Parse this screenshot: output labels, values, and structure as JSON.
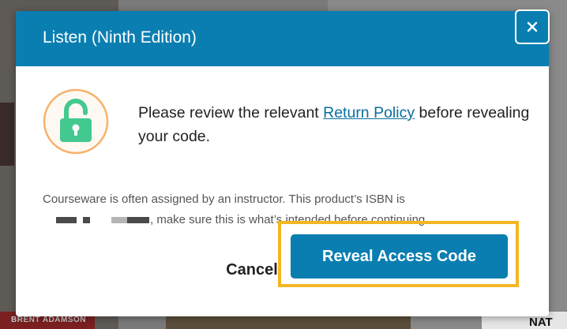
{
  "background": {
    "left_caption": "BRENT ADAMSON",
    "right_caption": "NAT"
  },
  "dialog": {
    "title": "Listen (Ninth Edition)",
    "close_icon": "close-icon",
    "lock_icon": "unlocked-padlock-icon",
    "message_before_link": "Please review the relevant ",
    "return_policy_link": "Return Policy",
    "message_after_link": " before revealing your code.",
    "note_line1": "Courseware is often assigned by an instructor. This product’s ISBN is",
    "note_line2": ", make sure this is what’s intended before continuing.",
    "cancel_label": "Cancel",
    "reveal_label": "Reveal Access Code"
  },
  "colors": {
    "header_blue": "#0a7eb1",
    "highlight_orange": "#f3b623",
    "lock_green": "#43c98f",
    "lock_ring": "#f6b26b"
  }
}
